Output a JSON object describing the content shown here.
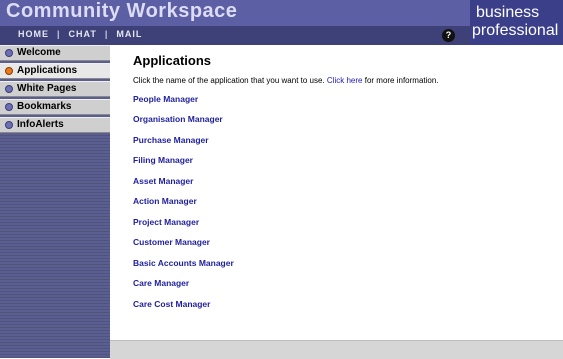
{
  "header": {
    "title": "Community Workspace",
    "nav": [
      "Home",
      "Chat",
      "Mail"
    ],
    "help_icon": "?",
    "brand_line1": "business",
    "brand_line2": "professional"
  },
  "sidebar": {
    "items": [
      {
        "label": "Welcome",
        "active": false
      },
      {
        "label": "Applications",
        "active": true
      },
      {
        "label": "White Pages",
        "active": false
      },
      {
        "label": "Bookmarks",
        "active": false
      },
      {
        "label": "InfoAlerts",
        "active": false
      }
    ]
  },
  "main": {
    "title": "Applications",
    "instruction_before": "Click the name of the application that you want to use.",
    "instruction_link": "Click here",
    "instruction_after": "for more information.",
    "apps": [
      "People Manager",
      "Organisation Manager",
      "Purchase Manager",
      "Filing Manager",
      "Asset Manager",
      "Action Manager",
      "Project Manager",
      "Customer Manager",
      "Basic Accounts Manager",
      "Care Manager",
      "Care Cost Manager"
    ]
  },
  "colors": {
    "header": "#5c5fa3",
    "navbar": "#3e4177",
    "link": "#1f1f9e",
    "active_bullet": "#e87a1c"
  }
}
